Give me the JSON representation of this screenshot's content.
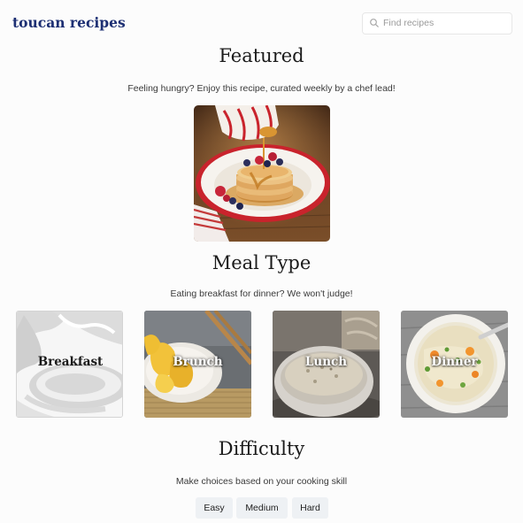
{
  "header": {
    "logo": "toucan recipes",
    "search_placeholder": "Find recipes"
  },
  "featured": {
    "heading": "Featured",
    "subtitle": "Feeling hungry? Enjoy this recipe, curated weekly by a chef lead!"
  },
  "meal_type": {
    "heading": "Meal Type",
    "subtitle": "Eating breakfast for dinner? We won't judge!",
    "items": [
      {
        "label": "Breakfast"
      },
      {
        "label": "Brunch"
      },
      {
        "label": "Lunch"
      },
      {
        "label": "Dinner"
      }
    ]
  },
  "difficulty": {
    "heading": "Difficulty",
    "subtitle": "Make choices based on your cooking skill",
    "options": [
      "Easy",
      "Medium",
      "Hard"
    ]
  }
}
